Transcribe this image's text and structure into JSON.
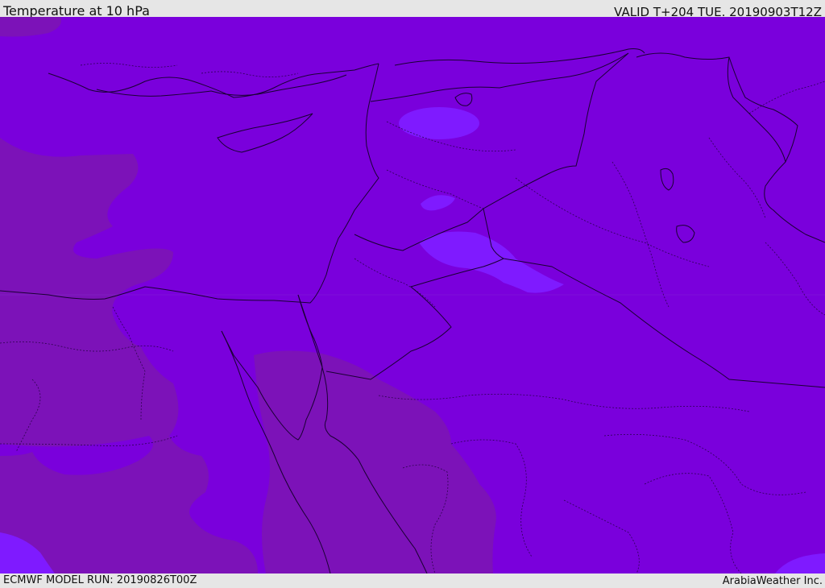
{
  "header": {
    "title": "Temperature at 10 hPa",
    "valid": "VALID T+204 TUE. 20190903T12Z"
  },
  "footer": {
    "model_run": "ECMWF MODEL RUN: 20190826T00Z",
    "credit": "ArabiaWeather Inc."
  },
  "map": {
    "colors": {
      "background_fill": "#7a00dc",
      "warm_region_fill": "#7c12b8",
      "cold_region_fill": "#7f1aff",
      "border_line": "#1a0033"
    }
  }
}
